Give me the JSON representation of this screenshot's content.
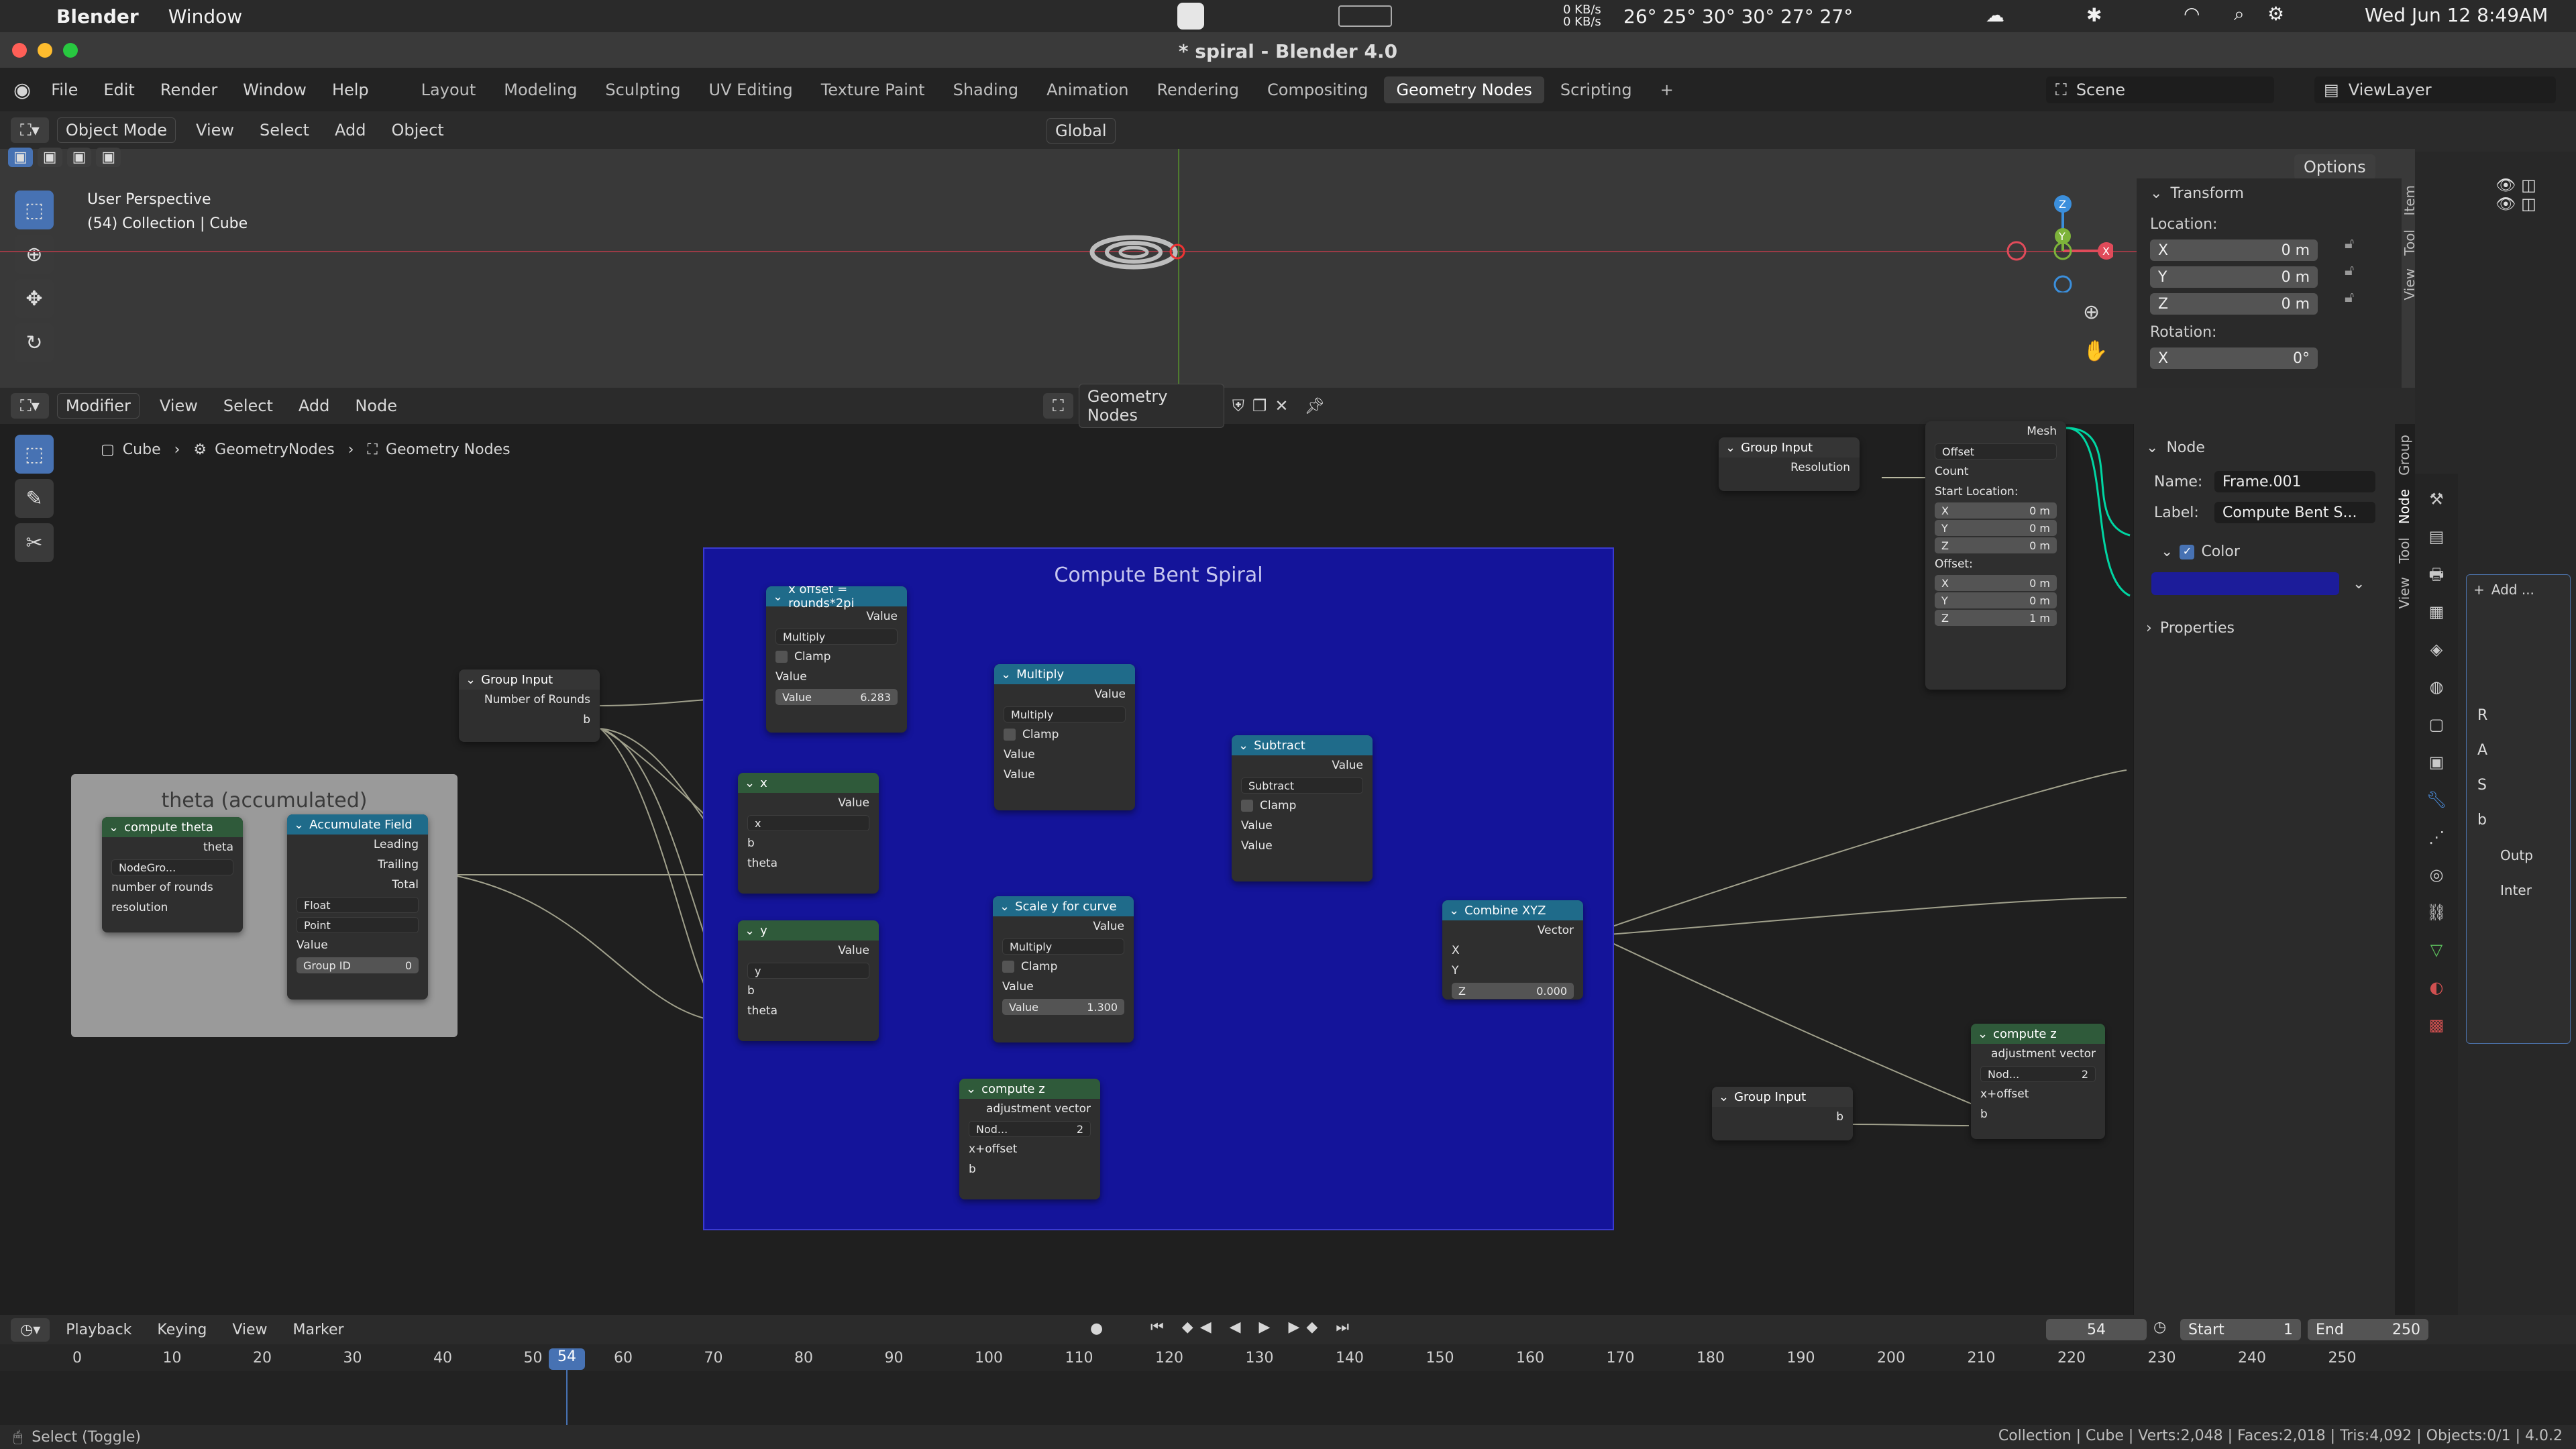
{
  "macbar": {
    "app": "Blender",
    "menu": "Window",
    "net": "0 KB/s\n0 KB/s",
    "temps": "26° 25° 30° 30° 27° 27°",
    "datetime": "Wed Jun 12  8:49AM"
  },
  "window": {
    "title": "* spiral - Blender 4.0"
  },
  "topbar": {
    "menus": [
      "File",
      "Edit",
      "Render",
      "Window",
      "Help"
    ],
    "workspaces": [
      "Layout",
      "Modeling",
      "Sculpting",
      "UV Editing",
      "Texture Paint",
      "Shading",
      "Animation",
      "Rendering",
      "Compositing",
      "Geometry Nodes",
      "Scripting"
    ],
    "active_workspace": "Geometry Nodes",
    "scene": "Scene",
    "viewlayer": "ViewLayer"
  },
  "viewport": {
    "mode": "Object Mode",
    "menus": [
      "View",
      "Select",
      "Add",
      "Object"
    ],
    "transform_orientation": "Global",
    "options": "Options",
    "overlay_title": "User Perspective",
    "overlay_sub": "(54) Collection | Cube",
    "gizmo": {
      "x": "X",
      "y": "Y",
      "z": "Z"
    },
    "tabs": [
      "Item",
      "Tool",
      "View"
    ],
    "transform": {
      "header": "Transform",
      "location_label": "Location:",
      "location": [
        {
          "axis": "X",
          "value": "0 m"
        },
        {
          "axis": "Y",
          "value": "0 m"
        },
        {
          "axis": "Z",
          "value": "0 m"
        }
      ],
      "rotation_label": "Rotation:",
      "rotation": [
        {
          "axis": "X",
          "value": "0°"
        }
      ]
    }
  },
  "node_editor": {
    "editor_type": "Modifier",
    "menus": [
      "View",
      "Select",
      "Add",
      "Node"
    ],
    "tree_name": "Geometry Nodes",
    "breadcrumb": [
      "Cube",
      "GeometryNodes",
      "Geometry Nodes"
    ],
    "frame_main": "Compute Bent Spiral",
    "frame_left": "theta (accumulated)",
    "nodes": {
      "xoffset": {
        "title": "x offset = rounds*2pi",
        "out": "Value",
        "op": "Multiply",
        "clamp": "Clamp",
        "in1": "Value",
        "val_label": "Value",
        "val": "6.283"
      },
      "multiply": {
        "title": "Multiply",
        "out": "Value",
        "op": "Multiply",
        "clamp": "Clamp",
        "in1": "Value",
        "in2": "Value"
      },
      "subtract": {
        "title": "Subtract",
        "out": "Value",
        "op": "Subtract",
        "clamp": "Clamp",
        "in1": "Value",
        "in2": "Value"
      },
      "scale_y": {
        "title": "Scale y for curve",
        "out": "Value",
        "op": "Multiply",
        "clamp": "Clamp",
        "in1": "Value",
        "val_label": "Value",
        "val": "1.300"
      },
      "combine": {
        "title": "Combine XYZ",
        "out": "Vector",
        "x": "X",
        "y": "Y",
        "z_label": "Z",
        "z": "0.000"
      },
      "xnode": {
        "title": "x",
        "out": "Value",
        "name": "x",
        "b": "b",
        "theta": "theta"
      },
      "ynode": {
        "title": "y",
        "out": "Value",
        "name": "y",
        "b": "b",
        "theta": "theta"
      },
      "compute_z": {
        "title": "compute z",
        "out": "adjustment vector",
        "name": "Nod...",
        "users": "2",
        "in1": "x+offset",
        "in2": "b"
      },
      "compute_z2": {
        "title": "compute z",
        "out": "adjustment vector",
        "name": "Nod...",
        "users": "2",
        "in1": "x+offset",
        "in2": "b"
      },
      "group_input": {
        "title": "Group Input",
        "out1": "Number of Rounds",
        "out2": "b"
      },
      "group_input2": {
        "title": "Group Input",
        "out1": "Resolution"
      },
      "group_input3": {
        "title": "Group Input",
        "out1": "b"
      },
      "compute_theta": {
        "title": "compute theta",
        "out": "theta",
        "name": "NodeGro...",
        "in1": "number of rounds",
        "in2": "resolution"
      },
      "accumulate": {
        "title": "Accumulate Field",
        "out1": "Leading",
        "out2": "Trailing",
        "out3": "Total",
        "type": "Float",
        "domain": "Point",
        "in1": "Value",
        "group_label": "Group ID",
        "group": "0"
      },
      "mesh_line": {
        "out": "Mesh",
        "mode": "Offset",
        "count": "Count",
        "start": "Start Location:",
        "start_vals": [
          {
            "a": "X",
            "v": "0 m"
          },
          {
            "a": "Y",
            "v": "0 m"
          },
          {
            "a": "Z",
            "v": "0 m"
          }
        ],
        "offset": "Offset:",
        "offset_vals": [
          {
            "a": "X",
            "v": "0 m"
          },
          {
            "a": "Y",
            "v": "0 m"
          },
          {
            "a": "Z",
            "v": "1 m"
          }
        ]
      }
    },
    "sidebar": {
      "section": "Node",
      "name_label": "Name:",
      "name": "Frame.001",
      "label_label": "Label:",
      "label": "Compute Bent S...",
      "color_label": "Color",
      "properties": "Properties",
      "tabs": [
        "Group",
        "Node",
        "Tool",
        "View"
      ],
      "color": "#1c1c9a"
    }
  },
  "properties": {
    "add": "Add ...",
    "labels": [
      "R",
      "A",
      "S",
      "b"
    ],
    "outp": "Outp",
    "inter": "Inter"
  },
  "timeline": {
    "menus": [
      "Playback",
      "Keying",
      "View",
      "Marker"
    ],
    "current": "54",
    "start_label": "Start",
    "start": "1",
    "end_label": "End",
    "end": "250",
    "ticks": [
      "0",
      "10",
      "20",
      "30",
      "40",
      "50",
      "60",
      "70",
      "80",
      "90",
      "100",
      "110",
      "120",
      "130",
      "140",
      "150",
      "160",
      "170",
      "180",
      "190",
      "200",
      "210",
      "220",
      "230",
      "240",
      "250"
    ]
  },
  "status": {
    "left": "Select (Toggle)",
    "right": "Collection | Cube | Verts:2,048 | Faces:2,018 | Tris:4,092 | Objects:0/1 | 4.0.2"
  },
  "colors": {
    "accent": "#4772b3",
    "frame": "#14149a",
    "frame_left": "#9a9a9a"
  }
}
